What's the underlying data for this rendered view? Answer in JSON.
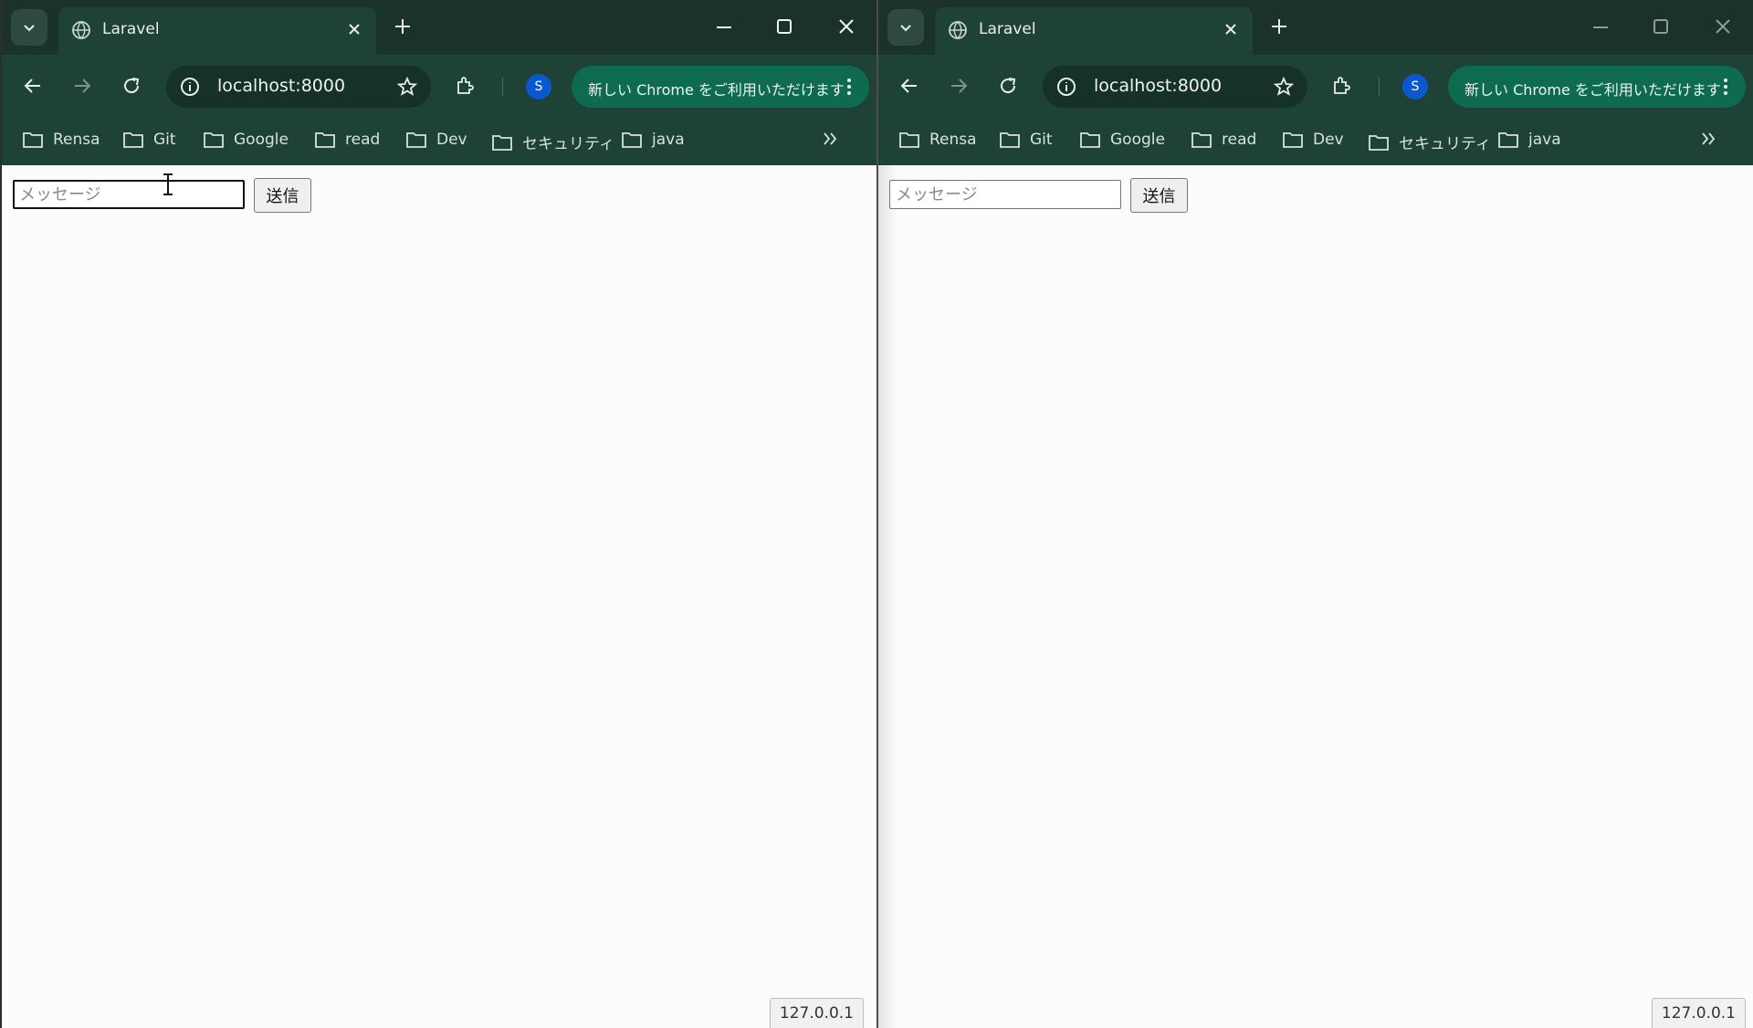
{
  "colors": {
    "tabstrip": "#1a3229",
    "toolbar": "#1f4236",
    "promo": "#0e6b50",
    "avatar": "#0b57d0",
    "page_bg": "#fcfcfc"
  },
  "windows": [
    {
      "id": "left",
      "tab_title": "Laravel",
      "url": "localhost:8000",
      "avatar_letter": "S",
      "promo_text": "新しい Chrome をご利用いただけます",
      "bookmarks": [
        "Rensa",
        "Git",
        "Google",
        "read",
        "Dev",
        "セキュリティ",
        "java"
      ],
      "message_placeholder": "メッセージ",
      "message_value": "",
      "send_label": "送信",
      "status_text": "127.0.0.1",
      "input_focused": true,
      "window_active": true
    },
    {
      "id": "right",
      "tab_title": "Laravel",
      "url": "localhost:8000",
      "avatar_letter": "S",
      "promo_text": "新しい Chrome をご利用いただけます",
      "bookmarks": [
        "Rensa",
        "Git",
        "Google",
        "read",
        "Dev",
        "セキュリティ",
        "java"
      ],
      "message_placeholder": "メッセージ",
      "message_value": "",
      "send_label": "送信",
      "status_text": "127.0.0.1",
      "input_focused": false,
      "window_active": false
    }
  ],
  "icons": {
    "tab_search": "chevron-down-icon",
    "favicon": "globe-icon",
    "tab_close": "close-icon",
    "new_tab": "plus-icon",
    "minimize": "minimize-icon",
    "maximize": "maximize-icon",
    "window_close": "close-icon",
    "back": "arrow-left-icon",
    "forward": "arrow-right-icon",
    "reload": "reload-icon",
    "site_info": "info-icon",
    "bookmark_star": "star-icon",
    "extensions": "puzzle-icon",
    "menu": "kebab-icon",
    "bookmark_folder": "folder-icon",
    "bookmarks_overflow": "double-chevron-right-icon",
    "text_cursor": "i-beam-cursor-icon"
  }
}
